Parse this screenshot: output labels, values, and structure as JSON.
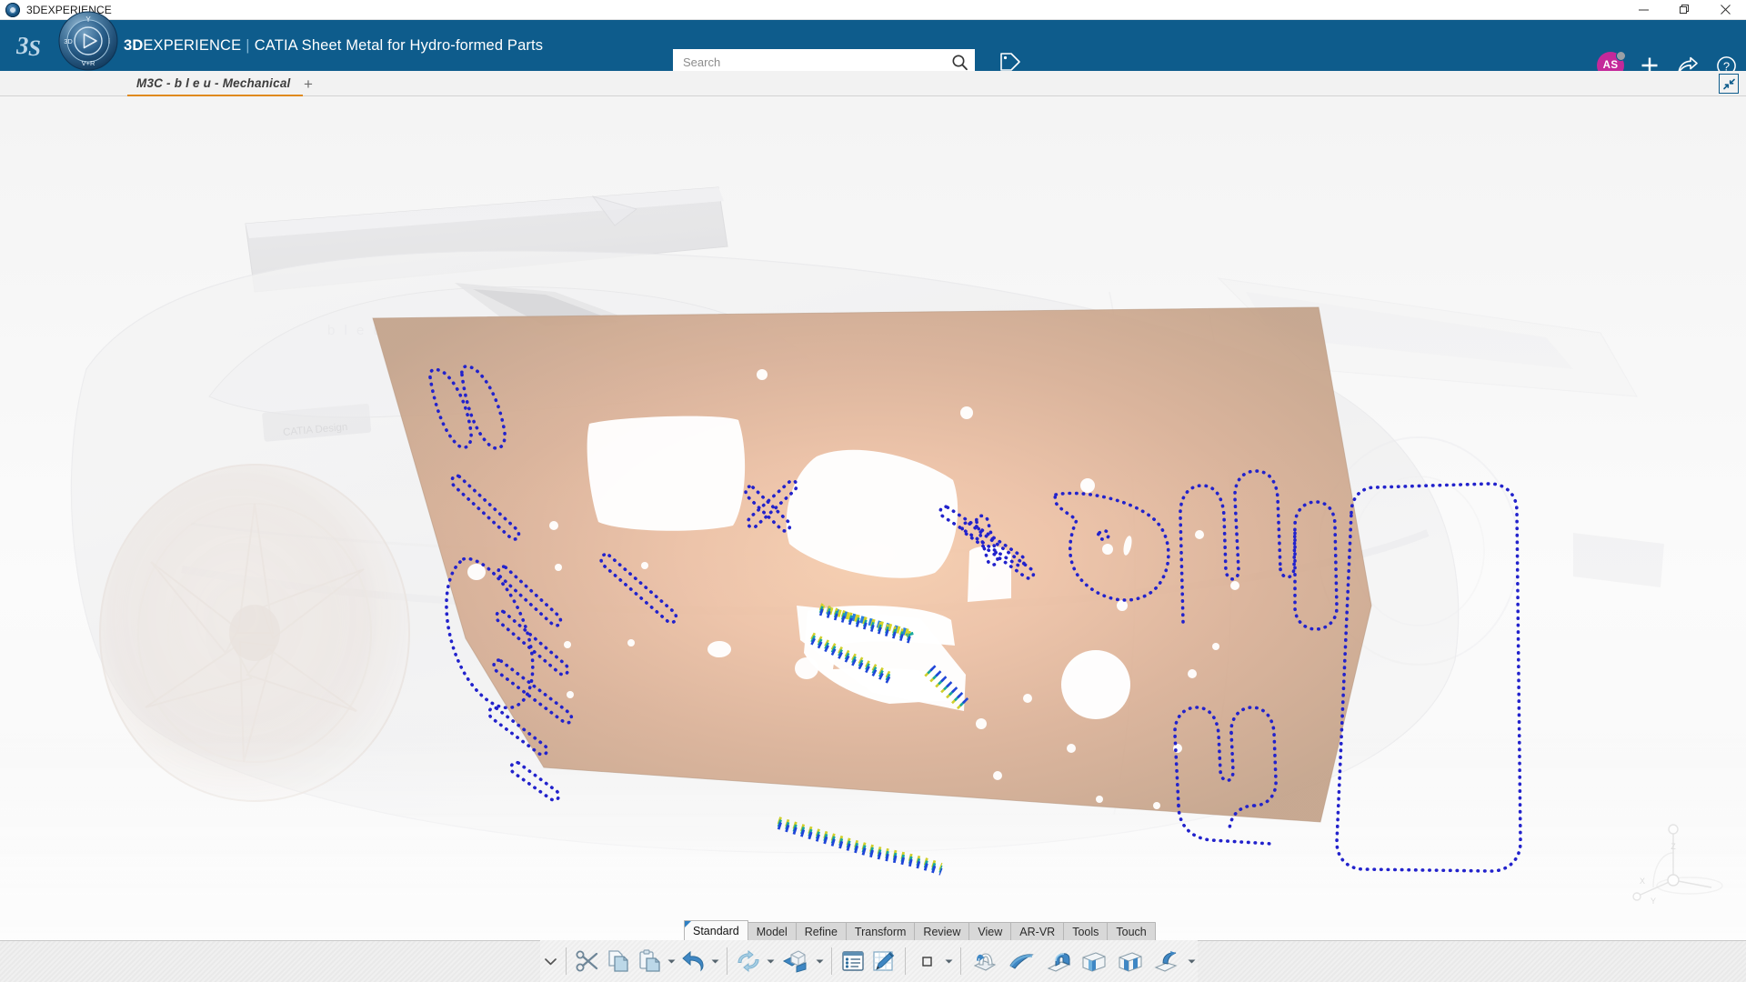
{
  "window": {
    "title": "3DEXPERIENCE",
    "app_icon": "3ds-logo-icon",
    "controls": [
      {
        "name": "minimize",
        "icon": "minimize-icon",
        "label": "—"
      },
      {
        "name": "restore",
        "icon": "restore-icon",
        "label": "❐"
      },
      {
        "name": "close",
        "icon": "close-icon",
        "label": "✕"
      }
    ]
  },
  "header": {
    "brand_bold": "3D",
    "brand_rest": "EXPERIENCE",
    "separator": "|",
    "app_name": "CATIA Sheet Metal for Hydro-formed Parts",
    "background_color": "#0e5c8c",
    "compass": {
      "name": "3dexperience-compass",
      "north": "Y",
      "west": "3D",
      "east": "i",
      "south": "V+R"
    },
    "search": {
      "placeholder": "Search",
      "value": "",
      "icon": "search-icon"
    },
    "tag_button": {
      "icon": "tag-icon",
      "label": "Tags"
    },
    "actions": [
      {
        "name": "user-avatar",
        "icon": "avatar",
        "initials": "AS",
        "color": "#c4299a",
        "status_color": "#9aa0a6"
      },
      {
        "name": "add-button",
        "icon": "plus-icon",
        "label": "+"
      },
      {
        "name": "share-button",
        "icon": "share-arrow-icon",
        "label": "Share"
      },
      {
        "name": "help-button",
        "icon": "help-question-icon",
        "label": "?"
      }
    ]
  },
  "tabstrip": {
    "active_tab": "M3C - b l e u - Mechanical",
    "add_tab_label": "+",
    "expand_icon": "collapse-diagonal-icon",
    "accent_color": "#e08a1e"
  },
  "viewport": {
    "name": "3d-viewport",
    "model_label": "CATIA Design",
    "badge_text": "b l e u",
    "surface_color": "#c8a68f",
    "highlight_color": "#f3c8ab",
    "curve_color": "#2222cc",
    "edge_curve_colors": [
      "#1a3fd6",
      "#13a8a8",
      "#2fc46a",
      "#d8d827"
    ],
    "axis_triad": {
      "x": "X",
      "y": "Y",
      "z": "Z"
    }
  },
  "actionbar": {
    "tabs": [
      {
        "label": "Standard",
        "active": true
      },
      {
        "label": "Model",
        "active": false
      },
      {
        "label": "Refine",
        "active": false
      },
      {
        "label": "Transform",
        "active": false
      },
      {
        "label": "Review",
        "active": false
      },
      {
        "label": "View",
        "active": false
      },
      {
        "label": "AR-VR",
        "active": false
      },
      {
        "label": "Tools",
        "active": false
      },
      {
        "label": "Touch",
        "active": false
      }
    ],
    "collapse_icon": "chevron-down-icon",
    "commands": [
      {
        "name": "cut",
        "icon": "scissors-icon",
        "label": "Cut",
        "has_caret": false
      },
      {
        "name": "copy",
        "icon": "copy-pages-icon",
        "label": "Copy",
        "has_caret": false
      },
      {
        "name": "paste",
        "icon": "clipboard-paste-icon",
        "label": "Paste",
        "has_caret": true
      },
      {
        "name": "undo",
        "icon": "undo-arrow-icon",
        "label": "Undo",
        "has_caret": true
      },
      {
        "name": "update",
        "icon": "update-cycle-icon",
        "label": "Update",
        "has_caret": true
      },
      {
        "name": "manipulate",
        "icon": "cube-manipulate-icon",
        "label": "Manipulate",
        "has_caret": true
      },
      {
        "name": "list-properties",
        "icon": "properties-list-icon",
        "label": "Properties",
        "has_caret": false
      },
      {
        "name": "sketch",
        "icon": "sketch-pencil-grid-icon",
        "label": "Sketch",
        "has_caret": false
      },
      {
        "name": "selection-mode",
        "icon": "square-select-icon",
        "label": "Selection",
        "has_caret": true
      },
      {
        "name": "hydroform",
        "icon": "hydroform-die-icon",
        "label": "Hydro-form",
        "has_caret": false
      },
      {
        "name": "surface-wall",
        "icon": "curved-wall-icon",
        "label": "Wall",
        "has_caret": false
      },
      {
        "name": "flange",
        "icon": "flange-icon",
        "label": "Flange",
        "has_caret": false
      },
      {
        "name": "bead",
        "icon": "bead-icon",
        "label": "Bead",
        "has_caret": false
      },
      {
        "name": "stamp",
        "icon": "stamp-icon",
        "label": "Stamp",
        "has_caret": false
      },
      {
        "name": "bend",
        "icon": "bend-from-flat-icon",
        "label": "Bend",
        "has_caret": true
      }
    ]
  }
}
